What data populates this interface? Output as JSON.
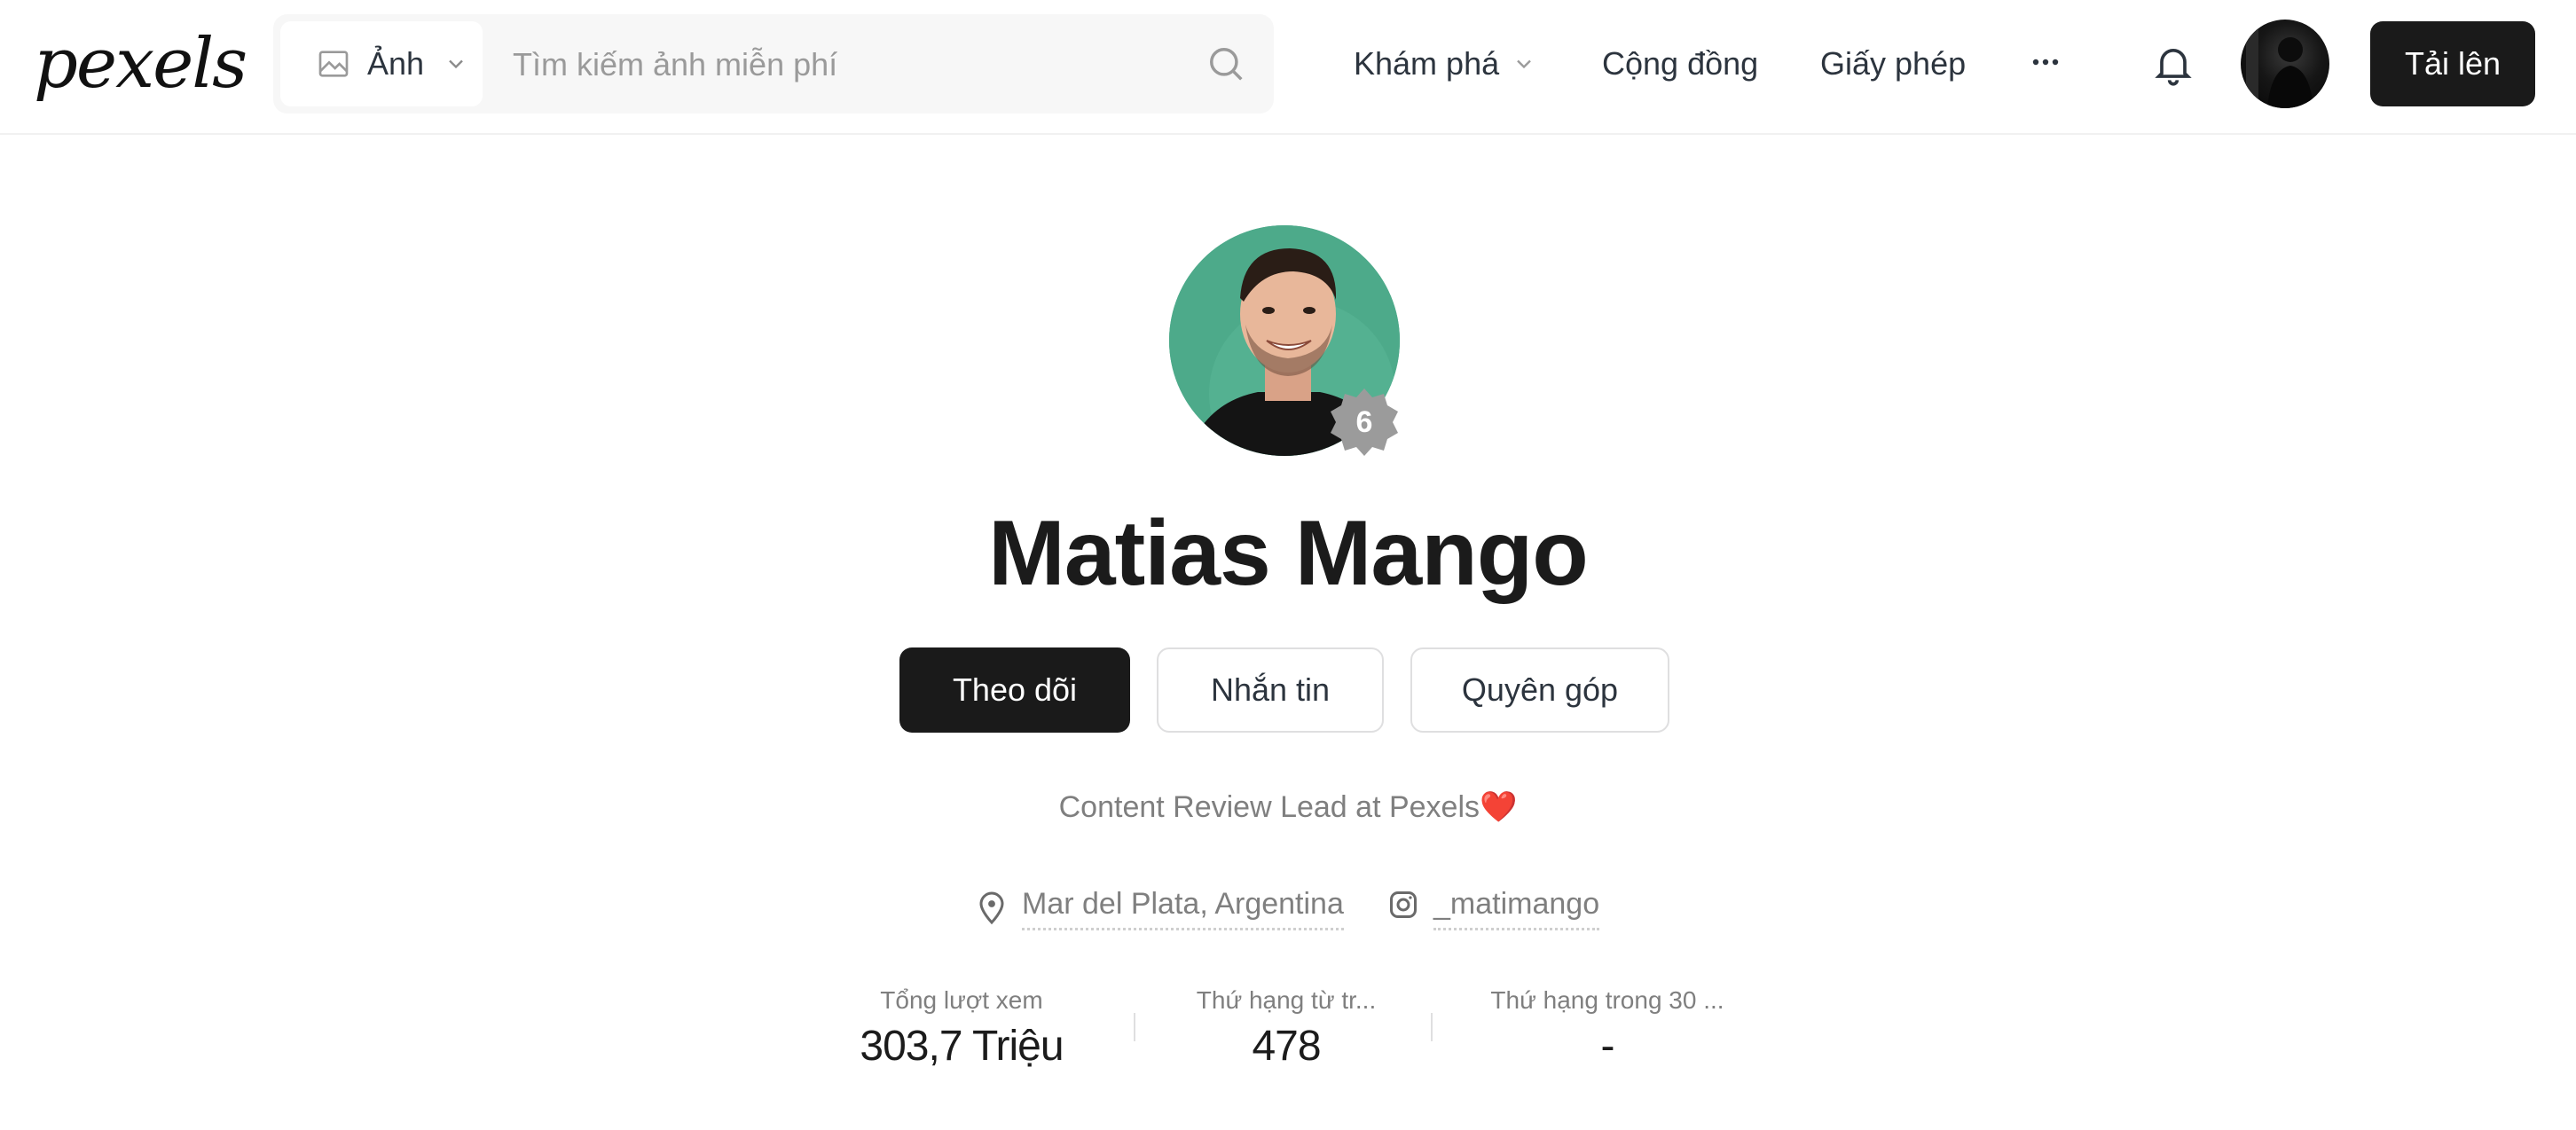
{
  "header": {
    "logo": "pexels",
    "search": {
      "type_label": "Ảnh",
      "placeholder": "Tìm kiếm ảnh miễn phí",
      "value": ""
    },
    "nav": {
      "explore": "Khám phá",
      "community": "Cộng đồng",
      "license": "Giấy phép"
    },
    "upload_label": "Tải lên"
  },
  "profile": {
    "name": "Matias Mango",
    "level": "6",
    "bio": "Content Review Lead at Pexels❤️",
    "location": "Mar del Plata, Argentina",
    "instagram": "_matimango",
    "actions": {
      "follow": "Theo dõi",
      "message": "Nhắn tin",
      "donate": "Quyên góp"
    },
    "stats": [
      {
        "label": "Tổng lượt xem",
        "value": "303,7 Triệu"
      },
      {
        "label": "Thứ hạng từ tr...",
        "value": "478"
      },
      {
        "label": "Thứ hạng trong 30 ...",
        "value": "-"
      }
    ]
  },
  "colors": {
    "primary_button": "#1a1a1a",
    "avatar_bg": "#4daa8a",
    "badge": "#9b9b9b",
    "muted_text": "#7f7f7f"
  },
  "icons": [
    "image-icon",
    "chevron-down-icon",
    "search-icon",
    "more-icon",
    "bell-icon",
    "location-pin-icon",
    "instagram-icon"
  ]
}
